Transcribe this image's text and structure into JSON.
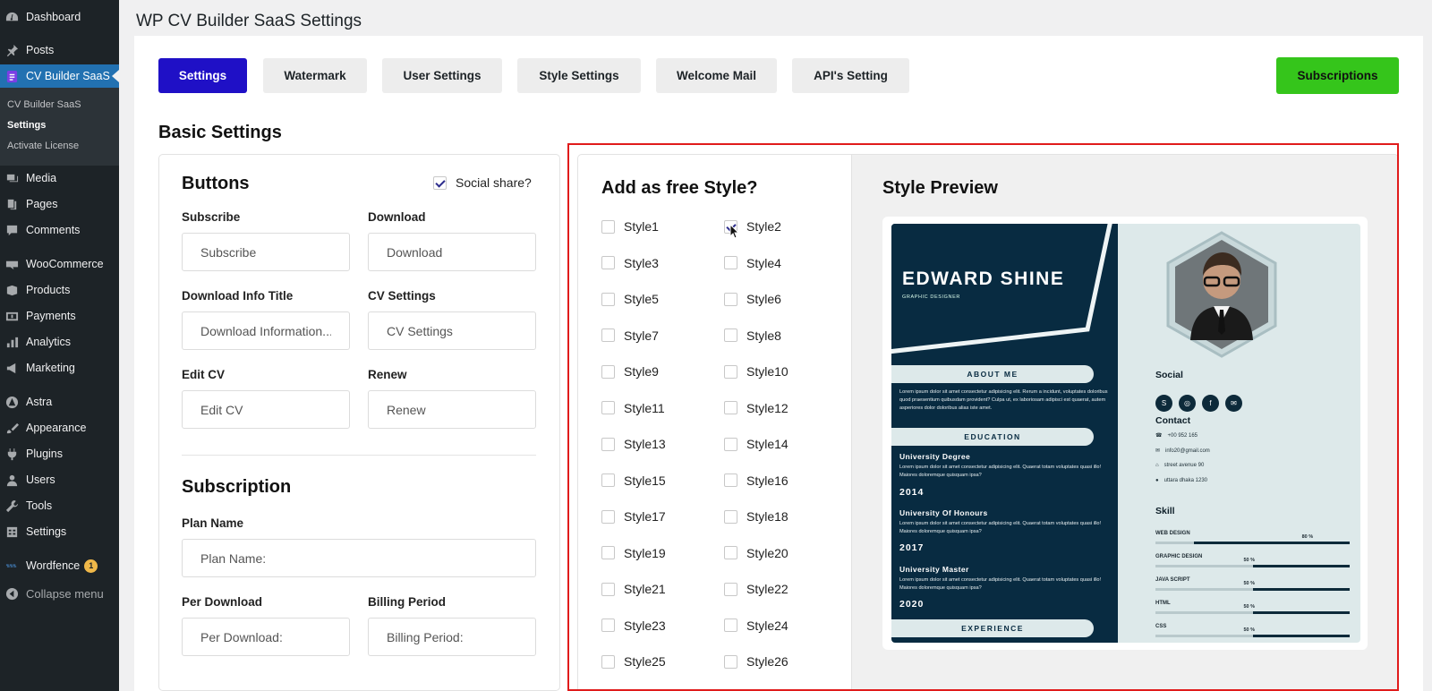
{
  "sidebar": {
    "items": [
      {
        "label": "Dashboard",
        "icon": "dashboard-icon"
      },
      {
        "label": "Posts",
        "icon": "pin-icon"
      },
      {
        "label": "CV Builder SaaS",
        "icon": "cv-builder-icon"
      },
      {
        "label": "Media",
        "icon": "media-icon"
      },
      {
        "label": "Pages",
        "icon": "pages-icon"
      },
      {
        "label": "Comments",
        "icon": "comments-icon"
      },
      {
        "label": "WooCommerce",
        "icon": "woocommerce-icon"
      },
      {
        "label": "Products",
        "icon": "products-icon"
      },
      {
        "label": "Payments",
        "icon": "payments-icon"
      },
      {
        "label": "Analytics",
        "icon": "analytics-icon"
      },
      {
        "label": "Marketing",
        "icon": "megaphone-icon"
      },
      {
        "label": "Astra",
        "icon": "astra-icon"
      },
      {
        "label": "Appearance",
        "icon": "brush-icon"
      },
      {
        "label": "Plugins",
        "icon": "plug-icon"
      },
      {
        "label": "Users",
        "icon": "user-icon"
      },
      {
        "label": "Tools",
        "icon": "wrench-icon"
      },
      {
        "label": "Settings",
        "icon": "settings-icon"
      },
      {
        "label": "Wordfence",
        "icon": "wordfence-icon",
        "badge": "1"
      },
      {
        "label": "Collapse menu",
        "icon": "collapse-icon"
      }
    ],
    "submenu": [
      "CV Builder SaaS",
      "Settings",
      "Activate License"
    ],
    "active_color": "#2271b1"
  },
  "page": {
    "title": "WP CV Builder SaaS Settings"
  },
  "tabs": [
    {
      "label": "Settings",
      "active": true
    },
    {
      "label": "Watermark"
    },
    {
      "label": "User Settings"
    },
    {
      "label": "Style Settings"
    },
    {
      "label": "Welcome Mail"
    },
    {
      "label": "API's Setting"
    }
  ],
  "subscriptions_label": "Subscriptions",
  "basic_settings": {
    "heading": "Basic Settings",
    "buttons_title": "Buttons",
    "social_share": {
      "label": "Social share?",
      "checked": true
    },
    "fields": {
      "subscribe": {
        "label": "Subscribe",
        "placeholder": "Subscribe"
      },
      "download": {
        "label": "Download",
        "placeholder": "Download"
      },
      "download_info": {
        "label": "Download Info Title",
        "placeholder": "Download Information..."
      },
      "cv_settings": {
        "label": "CV Settings",
        "placeholder": "CV Settings"
      },
      "edit_cv": {
        "label": "Edit CV",
        "placeholder": "Edit CV"
      },
      "renew": {
        "label": "Renew",
        "placeholder": "Renew"
      }
    },
    "subscription_title": "Subscription",
    "subscription_fields": {
      "plan_name": {
        "label": "Plan Name",
        "placeholder": "Plan Name:"
      },
      "per_download": {
        "label": "Per Download",
        "placeholder": "Per Download:"
      },
      "billing_period": {
        "label": "Billing Period",
        "placeholder": "Billing Period:"
      }
    }
  },
  "free_styles": {
    "heading": "Add as free Style?",
    "options": [
      "Style1",
      "Style2",
      "Style3",
      "Style4",
      "Style5",
      "Style6",
      "Style7",
      "Style8",
      "Style9",
      "Style10",
      "Style11",
      "Style12",
      "Style13",
      "Style14",
      "Style15",
      "Style16",
      "Style17",
      "Style18",
      "Style19",
      "Style20",
      "Style21",
      "Style22",
      "Style23",
      "Style24",
      "Style25",
      "Style26"
    ],
    "checked": [
      "Style2"
    ]
  },
  "preview": {
    "heading": "Style Preview",
    "cv": {
      "name": "EDWARD SHINE",
      "role": "GRAPHIC DESIGNER",
      "about_heading": "ABOUT ME",
      "about_text": "Lorem ipsum dolor sit amet consectetur adipisicing elit. Rerum a incidunt, voluptates doloribus quod praesentium quibusdam provident? Culpa ut, ex laboriosam adipisci est quaerat, autem asperiores dolor doloribus alias iste amet.",
      "education_heading": "EDUCATION",
      "education": [
        {
          "degree": "University Degree",
          "text": "Lorem ipsum dolor sit amet consectetur adipisicing elit. Quaerat totam voluptates quasi illo! Maiores doloremque quisquam ipsa?",
          "year": "2014"
        },
        {
          "degree": "University Of Honours",
          "text": "Lorem ipsum dolor sit amet consectetur adipisicing elit. Quaerat totam voluptates quasi illo! Maiores doloremque quisquam ipsa?",
          "year": "2017"
        },
        {
          "degree": "University Master",
          "text": "Lorem ipsum dolor sit amet consectetur adipisicing elit. Quaerat totam voluptates quasi illo! Maiores doloremque quisquam ipsa?",
          "year": "2020"
        }
      ],
      "experience_heading": "EXPERIENCE",
      "social_heading": "Social",
      "social_icons": [
        "skype-icon",
        "instagram-icon",
        "facebook-icon",
        "email-icon"
      ],
      "contact_heading": "Contact",
      "contacts": [
        {
          "icon": "phone-icon",
          "text": "+00 952 165"
        },
        {
          "icon": "mail-icon",
          "text": "info20@gmail.com"
        },
        {
          "icon": "home-icon",
          "text": "street avenue 90"
        },
        {
          "icon": "location-icon",
          "text": "uttara dhaka 1230"
        }
      ],
      "skill_heading": "Skill",
      "skills": [
        {
          "name": "WEB DESIGN",
          "pct_label": "80 %",
          "level": 0.8
        },
        {
          "name": "GRAPHIC DESIGN",
          "pct_label": "50 %",
          "level": 0.5
        },
        {
          "name": "JAVA SCRIPT",
          "pct_label": "50 %",
          "level": 0.5
        },
        {
          "name": "HTML",
          "pct_label": "50 %",
          "level": 0.5
        },
        {
          "name": "CSS",
          "pct_label": "50 %",
          "level": 0.5
        }
      ],
      "colors": {
        "dark": "#082b41",
        "light": "#dde9ea"
      }
    }
  },
  "colors": {
    "primary_tab": "#1f10c6",
    "subscriptions": "#35c51b",
    "highlight": "#e01b1b"
  }
}
